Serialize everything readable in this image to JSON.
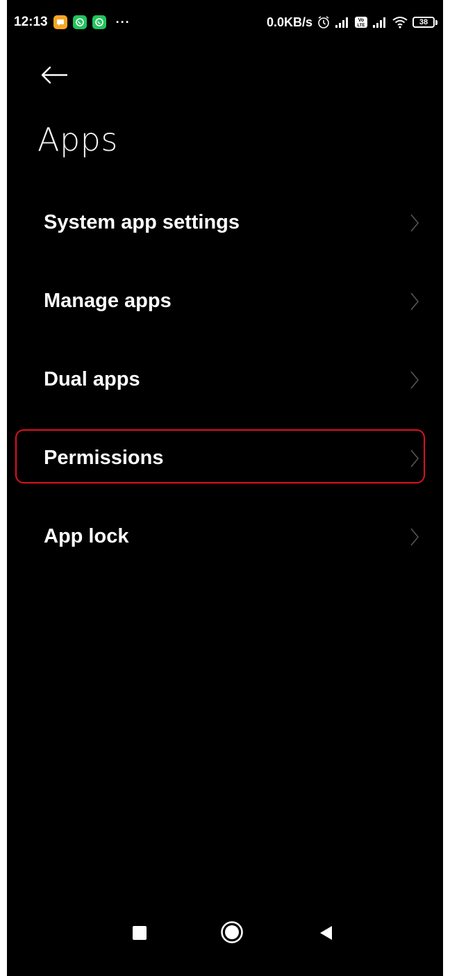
{
  "status_bar": {
    "time": "12:13",
    "more": "···",
    "net_speed": "0.0KB/s",
    "battery_level": "38",
    "icons": [
      "message-app-icon",
      "whatsapp-icon",
      "whatsapp-icon",
      "alarm-icon",
      "signal-icon",
      "volte-icon",
      "signal-icon",
      "wifi-icon",
      "battery-icon"
    ]
  },
  "header": {
    "title": "Apps"
  },
  "menu": {
    "items": [
      {
        "label": "System app settings"
      },
      {
        "label": "Manage apps"
      },
      {
        "label": "Dual apps"
      },
      {
        "label": "Permissions",
        "highlighted": true
      },
      {
        "label": "App lock"
      }
    ]
  },
  "colors": {
    "background": "#000000",
    "text": "#ffffff",
    "chevron": "#555555",
    "highlight": "#e01020"
  },
  "nav_bar": {
    "buttons": [
      "recents-icon",
      "home-icon",
      "back-triangle-icon"
    ]
  }
}
